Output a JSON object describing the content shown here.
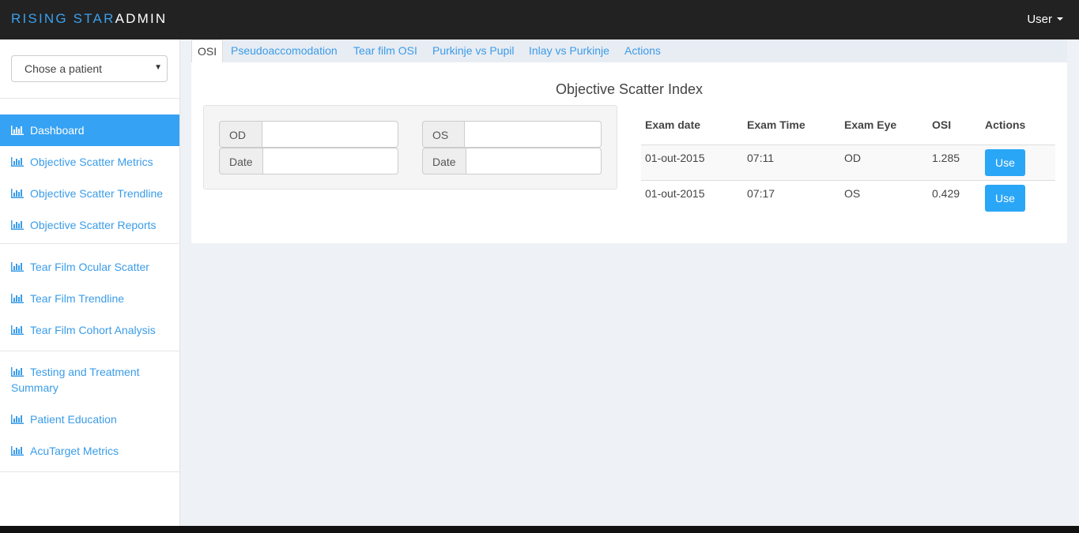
{
  "brand": {
    "part1": "RISING STAR",
    "part2": "ADMIN"
  },
  "header": {
    "user_label": "User"
  },
  "patient_select": {
    "value": "Chose a patient"
  },
  "sidebar": {
    "items": [
      {
        "label": "Dashboard",
        "active": true
      },
      {
        "label": "Objective Scatter Metrics"
      },
      {
        "label": "Objective Scatter Trendline"
      },
      {
        "label": "Objective Scatter Reports"
      },
      {
        "label": "Tear Film Ocular Scatter"
      },
      {
        "label": "Tear Film Trendline"
      },
      {
        "label": "Tear Film Cohort Analysis"
      },
      {
        "label": "Testing and Treatment Summary"
      },
      {
        "label": "Patient Education"
      },
      {
        "label": "AcuTarget Metrics"
      }
    ]
  },
  "tabs": [
    "OSI",
    "Pseudoaccomodation",
    "Tear film OSI",
    "Purkinje vs Pupil",
    "Inlay vs Purkinje",
    "Actions"
  ],
  "panel": {
    "title": "Objective Scatter Index"
  },
  "form": {
    "od_label": "OD",
    "od_value": "",
    "od_date_label": "Date",
    "od_date_value": "",
    "os_label": "OS",
    "os_value": "",
    "os_date_label": "Date",
    "os_date_value": ""
  },
  "table": {
    "headers": [
      "Exam date",
      "Exam Time",
      "Exam Eye",
      "OSI",
      "Actions"
    ],
    "rows": [
      {
        "date": "01-out-2015",
        "time": "07:11",
        "eye": "OD",
        "osi": "1.285",
        "action": "Use"
      },
      {
        "date": "01-out-2015",
        "time": "07:17",
        "eye": "OS",
        "osi": "0.429",
        "action": "Use"
      }
    ]
  },
  "colors": {
    "accent": "#36a2f3",
    "link": "#3a9ce8",
    "topbar": "#222222"
  }
}
